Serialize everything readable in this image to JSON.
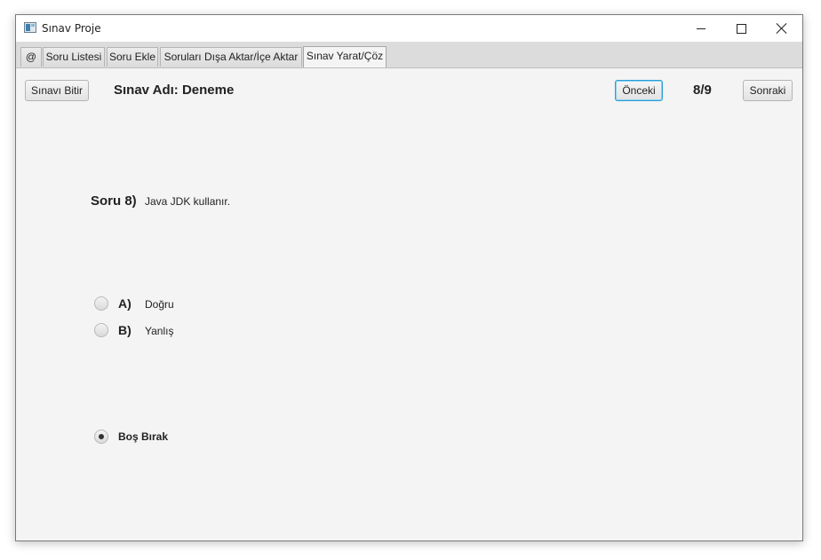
{
  "window": {
    "title": "Sınav Proje"
  },
  "tabs": [
    {
      "label": "@"
    },
    {
      "label": "Soru Listesi"
    },
    {
      "label": "Soru Ekle"
    },
    {
      "label": "Soruları Dışa Aktar/İçe Aktar"
    },
    {
      "label": "Sınav Yarat/Çöz",
      "active": true
    }
  ],
  "toolbar": {
    "finish_label": "Sınavı Bitir",
    "exam_name": "Sınav Adı: Deneme",
    "prev_label": "Önceki",
    "counter": "8/9",
    "next_label": "Sonraki"
  },
  "question": {
    "label": "Soru 8)",
    "text": "Java JDK kullanır."
  },
  "options": [
    {
      "letter": "A)",
      "text": "Doğru",
      "selected": false
    },
    {
      "letter": "B)",
      "text": "Yanlış",
      "selected": false
    }
  ],
  "skip": {
    "label": "Boş Bırak",
    "selected": true
  }
}
